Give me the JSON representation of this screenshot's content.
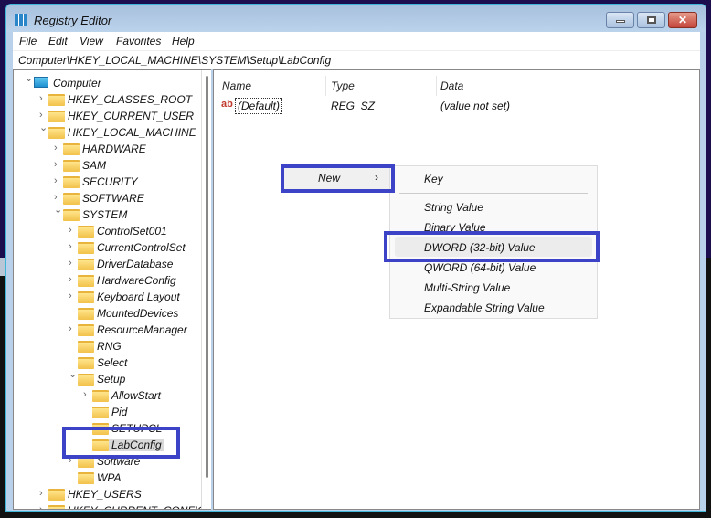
{
  "window": {
    "title": "Registry Editor",
    "close_glyph": "✕"
  },
  "menu": [
    "File",
    "Edit",
    "View",
    "Favorites",
    "Help"
  ],
  "address": "Computer\\HKEY_LOCAL_MACHINE\\SYSTEM\\Setup\\LabConfig",
  "tree": [
    {
      "label": "Computer",
      "level": 0,
      "exp": "open",
      "icon": "computer"
    },
    {
      "label": "HKEY_CLASSES_ROOT",
      "level": 1,
      "exp": "closed"
    },
    {
      "label": "HKEY_CURRENT_USER",
      "level": 1,
      "exp": "closed"
    },
    {
      "label": "HKEY_LOCAL_MACHINE",
      "level": 1,
      "exp": "open"
    },
    {
      "label": "HARDWARE",
      "level": 2,
      "exp": "closed"
    },
    {
      "label": "SAM",
      "level": 2,
      "exp": "closed"
    },
    {
      "label": "SECURITY",
      "level": 2,
      "exp": "closed"
    },
    {
      "label": "SOFTWARE",
      "level": 2,
      "exp": "closed"
    },
    {
      "label": "SYSTEM",
      "level": 2,
      "exp": "open"
    },
    {
      "label": "ControlSet001",
      "level": 3,
      "exp": "closed"
    },
    {
      "label": "CurrentControlSet",
      "level": 3,
      "exp": "closed"
    },
    {
      "label": "DriverDatabase",
      "level": 3,
      "exp": "closed"
    },
    {
      "label": "HardwareConfig",
      "level": 3,
      "exp": "closed"
    },
    {
      "label": "Keyboard Layout",
      "level": 3,
      "exp": "closed"
    },
    {
      "label": "MountedDevices",
      "level": 3,
      "exp": "none"
    },
    {
      "label": "ResourceManager",
      "level": 3,
      "exp": "closed"
    },
    {
      "label": "RNG",
      "level": 3,
      "exp": "none"
    },
    {
      "label": "Select",
      "level": 3,
      "exp": "none"
    },
    {
      "label": "Setup",
      "level": 3,
      "exp": "open"
    },
    {
      "label": "AllowStart",
      "level": 4,
      "exp": "closed"
    },
    {
      "label": "Pid",
      "level": 4,
      "exp": "none"
    },
    {
      "label": "SETUPCL",
      "level": 4,
      "exp": "none"
    },
    {
      "label": "LabConfig",
      "level": 4,
      "exp": "none",
      "selected": true
    },
    {
      "label": "Software",
      "level": 3,
      "exp": "closed"
    },
    {
      "label": "WPA",
      "level": 3,
      "exp": "none"
    },
    {
      "label": "HKEY_USERS",
      "level": 1,
      "exp": "closed"
    },
    {
      "label": "HKEY_CURRENT_CONFIG",
      "level": 1,
      "exp": "closed"
    }
  ],
  "list": {
    "headers": {
      "name": "Name",
      "type": "Type",
      "data": "Data"
    },
    "rows": [
      {
        "name": "(Default)",
        "type": "REG_SZ",
        "data": "(value not set)",
        "icon": "ab"
      }
    ]
  },
  "context_menu": {
    "new_label": "New",
    "arrow": "›"
  },
  "submenu": [
    "Key",
    "String Value",
    "Binary Value",
    "DWORD (32-bit) Value",
    "QWORD (64-bit) Value",
    "Multi-String Value",
    "Expandable String Value"
  ],
  "highlight_color": "#3d43c6"
}
